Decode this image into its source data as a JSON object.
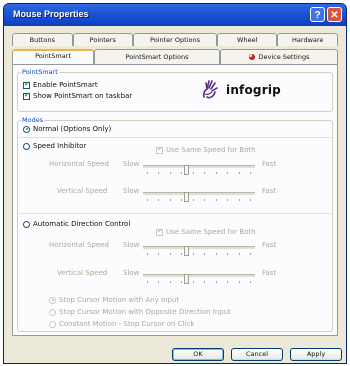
{
  "window": {
    "title": "Mouse Properties",
    "help_label": "?",
    "close_label": "✕"
  },
  "tabs_row1": [
    "Buttons",
    "Pointers",
    "Pointer Options",
    "Wheel",
    "Hardware"
  ],
  "tabs_row2": [
    {
      "label": "PointSmart",
      "active": true
    },
    {
      "label": "PointSmart Options",
      "active": false
    },
    {
      "label": "Device Settings",
      "active": false,
      "icon": "device-settings-icon"
    }
  ],
  "pointsmart": {
    "group_label": "PointSmart",
    "enable_label": "Enable PointSmart",
    "enable_checked": true,
    "taskbar_label": "Show PointSmart on taskbar",
    "taskbar_checked": true,
    "logo_text": "infogrip"
  },
  "modes": {
    "group_label": "Modes",
    "normal_label": "Normal (Options Only)",
    "normal_selected": true,
    "speed_inhibitor": {
      "label": "Speed Inhibitor",
      "selected": false,
      "same_speed_label": "Use Same Speed for Both",
      "same_speed_checked": true,
      "horizontal_label": "Horizontal Speed",
      "vertical_label": "Vertical Speed",
      "slow_label": "Slow",
      "fast_label": "Fast",
      "horizontal_value": 0.38,
      "vertical_value": 0.38
    },
    "automatic_direction": {
      "label": "Automatic Direction Control",
      "selected": false,
      "same_speed_label": "Use Same Speed for Both",
      "same_speed_checked": true,
      "horizontal_label": "Horizontal Speed",
      "vertical_label": "Vertical Speed",
      "slow_label": "Slow",
      "fast_label": "Fast",
      "horizontal_value": 0.38,
      "vertical_value": 0.38,
      "options": [
        {
          "label": "Stop Cursor Motion with Any Input",
          "selected": true
        },
        {
          "label": "Stop Cursor Motion with Opposite Direction Input",
          "selected": false
        },
        {
          "label": "Constant Motion - Stop Cursor on Click",
          "selected": false
        }
      ]
    }
  },
  "buttons": {
    "ok": "OK",
    "cancel": "Cancel",
    "apply": "Apply"
  },
  "colors": {
    "title_bar": "#1c55d6",
    "group_label": "#0046d5",
    "active_tab": "#f3b14b",
    "check": "#21a121"
  }
}
